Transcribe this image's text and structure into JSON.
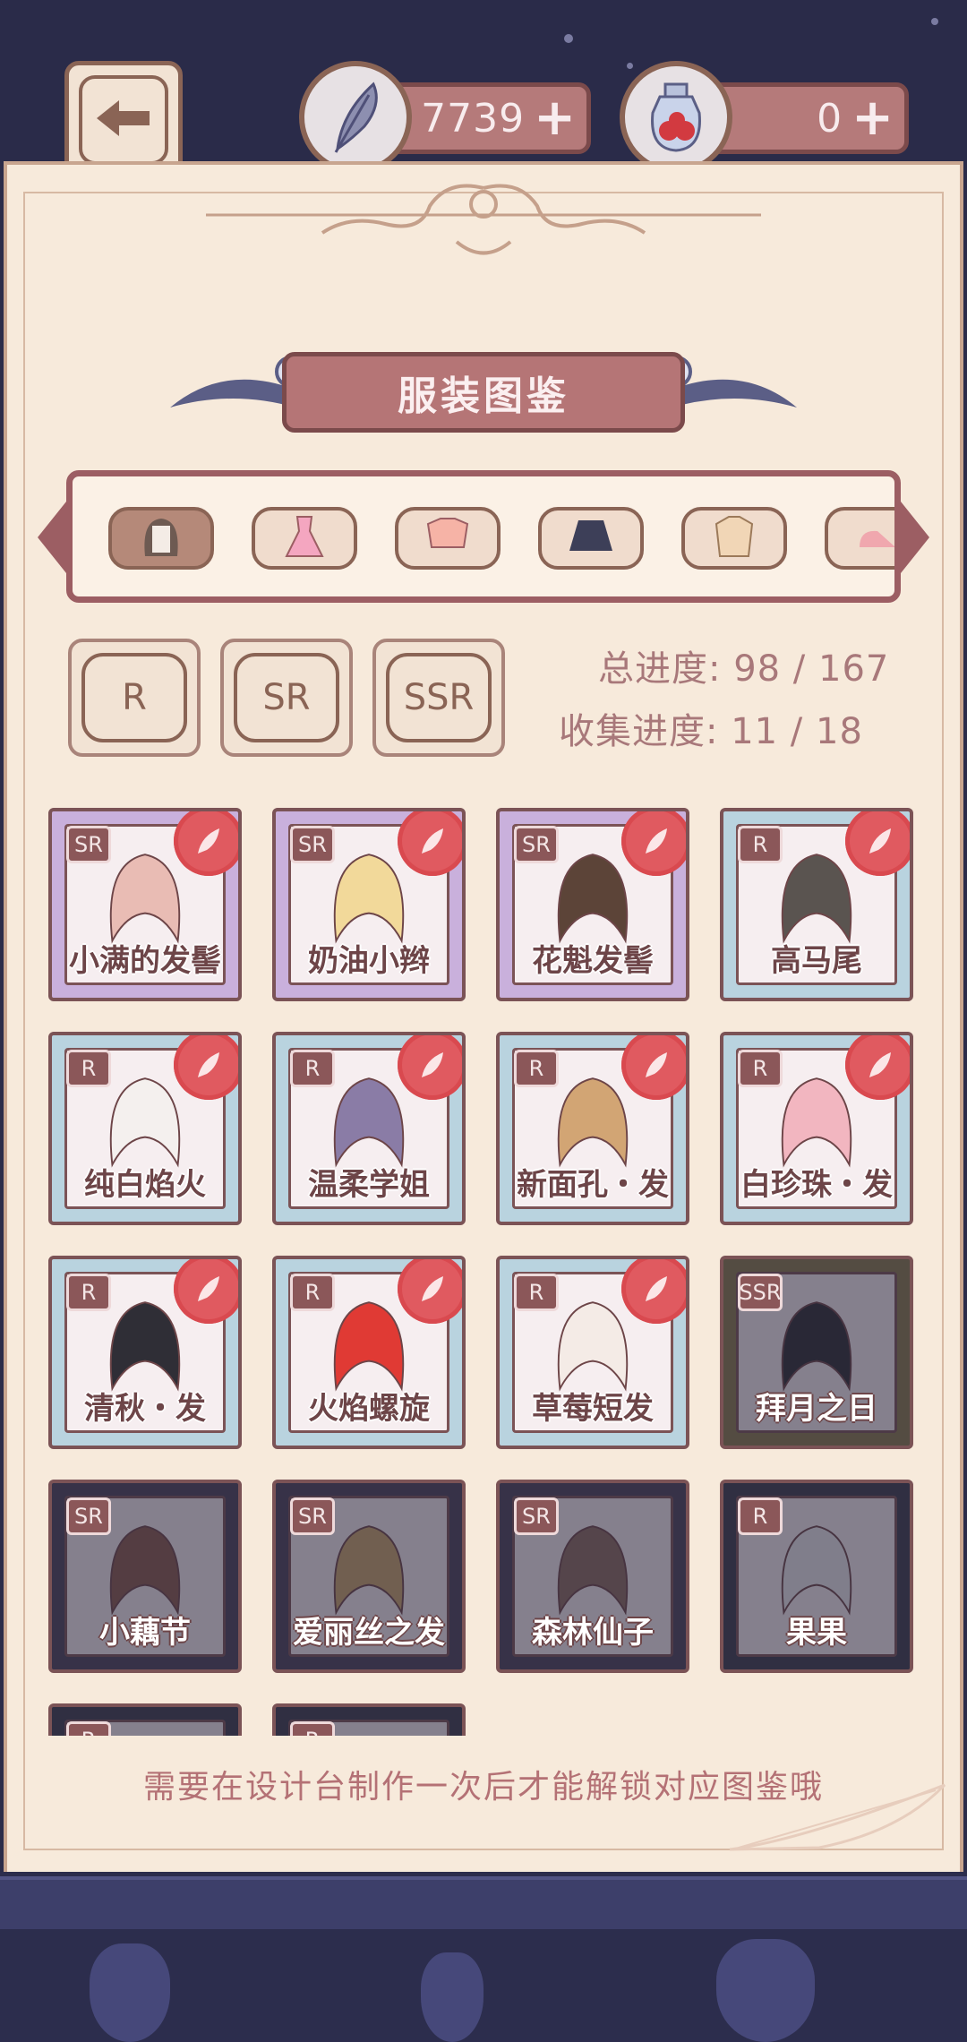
{
  "topbar": {
    "feather_count": "7739",
    "potion_count": "0",
    "plus": "+"
  },
  "title": "服装图鉴",
  "categories": [
    {
      "icon": "hair-icon"
    },
    {
      "icon": "dress-icon"
    },
    {
      "icon": "top-icon"
    },
    {
      "icon": "skirt-icon"
    },
    {
      "icon": "coat-icon"
    },
    {
      "icon": "shoe-icon"
    }
  ],
  "rarity_filters": [
    "R",
    "SR",
    "SSR"
  ],
  "progress": {
    "total": "总进度: 98 / 167",
    "collect": "收集进度: 11 / 18"
  },
  "items": [
    {
      "name": "小满的发髻",
      "rarity": "SR",
      "unlocked": true
    },
    {
      "name": "奶油小辫",
      "rarity": "SR",
      "unlocked": true
    },
    {
      "name": "花魁发髻",
      "rarity": "SR",
      "unlocked": true
    },
    {
      "name": "高马尾",
      "rarity": "R",
      "unlocked": true
    },
    {
      "name": "纯白焰火",
      "rarity": "R",
      "unlocked": true
    },
    {
      "name": "温柔学姐",
      "rarity": "R",
      "unlocked": true
    },
    {
      "name": "新面孔・发",
      "rarity": "R",
      "unlocked": true
    },
    {
      "name": "白珍珠・发",
      "rarity": "R",
      "unlocked": true
    },
    {
      "name": "清秋・发",
      "rarity": "R",
      "unlocked": true
    },
    {
      "name": "火焰螺旋",
      "rarity": "R",
      "unlocked": true
    },
    {
      "name": "草莓短发",
      "rarity": "R",
      "unlocked": true
    },
    {
      "name": "拜月之日",
      "rarity": "SSR",
      "unlocked": false
    },
    {
      "name": "小藕节",
      "rarity": "SR",
      "unlocked": false
    },
    {
      "name": "爱丽丝之发",
      "rarity": "SR",
      "unlocked": false
    },
    {
      "name": "森林仙子",
      "rarity": "SR",
      "unlocked": false
    },
    {
      "name": "果果",
      "rarity": "R",
      "unlocked": false
    },
    {
      "name": "",
      "rarity": "R",
      "unlocked": false
    },
    {
      "name": "",
      "rarity": "R",
      "unlocked": false
    }
  ],
  "hint": "需要在设计台制作一次后才能解锁对应图鉴哦",
  "colors": {
    "accent": "#b57576",
    "paper": "#f7eadb",
    "seal": "#e05a60"
  }
}
